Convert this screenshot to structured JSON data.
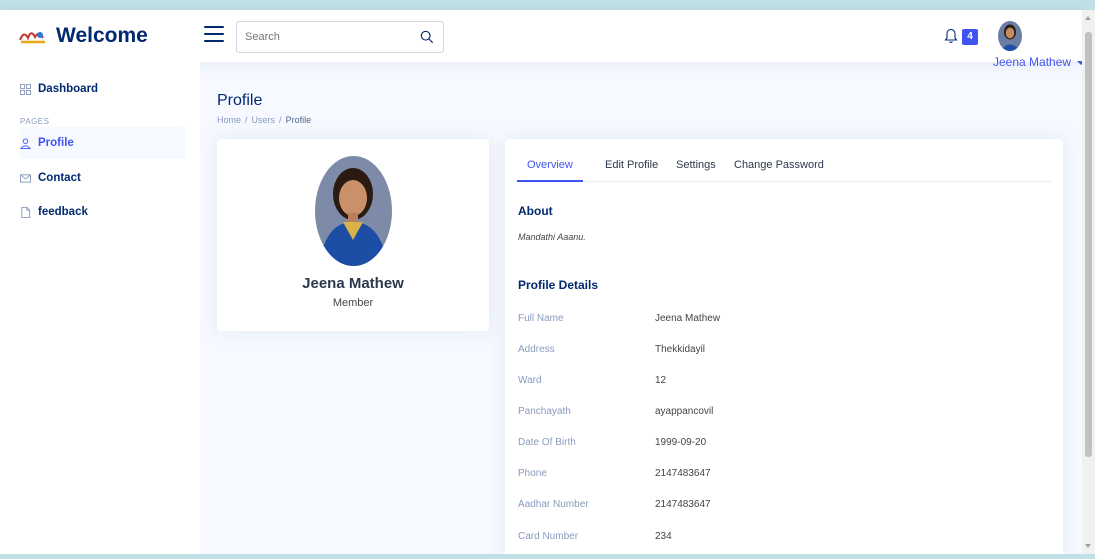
{
  "header": {
    "logo_text": "Welcome",
    "search_placeholder": "Search",
    "notification_count": "4",
    "user_name": "Jeena Mathew"
  },
  "sidebar": {
    "items": [
      {
        "label": "Dashboard",
        "icon": "grid-icon"
      },
      {
        "label": "Profile",
        "icon": "person-icon"
      },
      {
        "label": "Contact",
        "icon": "envelope-icon"
      },
      {
        "label": "feedback",
        "icon": "file-icon"
      }
    ],
    "heading": "PAGES"
  },
  "page": {
    "title": "Profile",
    "breadcrumb": [
      "Home",
      "Users",
      "Profile"
    ]
  },
  "profile_card": {
    "name": "Jeena Mathew",
    "role": "Member"
  },
  "tabs": [
    "Overview",
    "Edit Profile",
    "Settings",
    "Change Password"
  ],
  "overview": {
    "about_title": "About",
    "about_text": "Mandathi Aaanu.",
    "details_title": "Profile Details",
    "details": [
      {
        "label": "Full Name",
        "value": "Jeena Mathew"
      },
      {
        "label": "Address",
        "value": "Thekkidayil"
      },
      {
        "label": "Ward",
        "value": "12"
      },
      {
        "label": "Panchayath",
        "value": "ayappancovil"
      },
      {
        "label": "Date Of Birth",
        "value": "1999-09-20"
      },
      {
        "label": "Phone",
        "value": "2147483647"
      },
      {
        "label": "Aadhar Number",
        "value": "2147483647"
      },
      {
        "label": "Card Number",
        "value": "234"
      }
    ]
  },
  "colors": {
    "accent": "#4154f1",
    "navy": "#012970",
    "muted": "#899bbd",
    "background": "#f6f9ff"
  }
}
